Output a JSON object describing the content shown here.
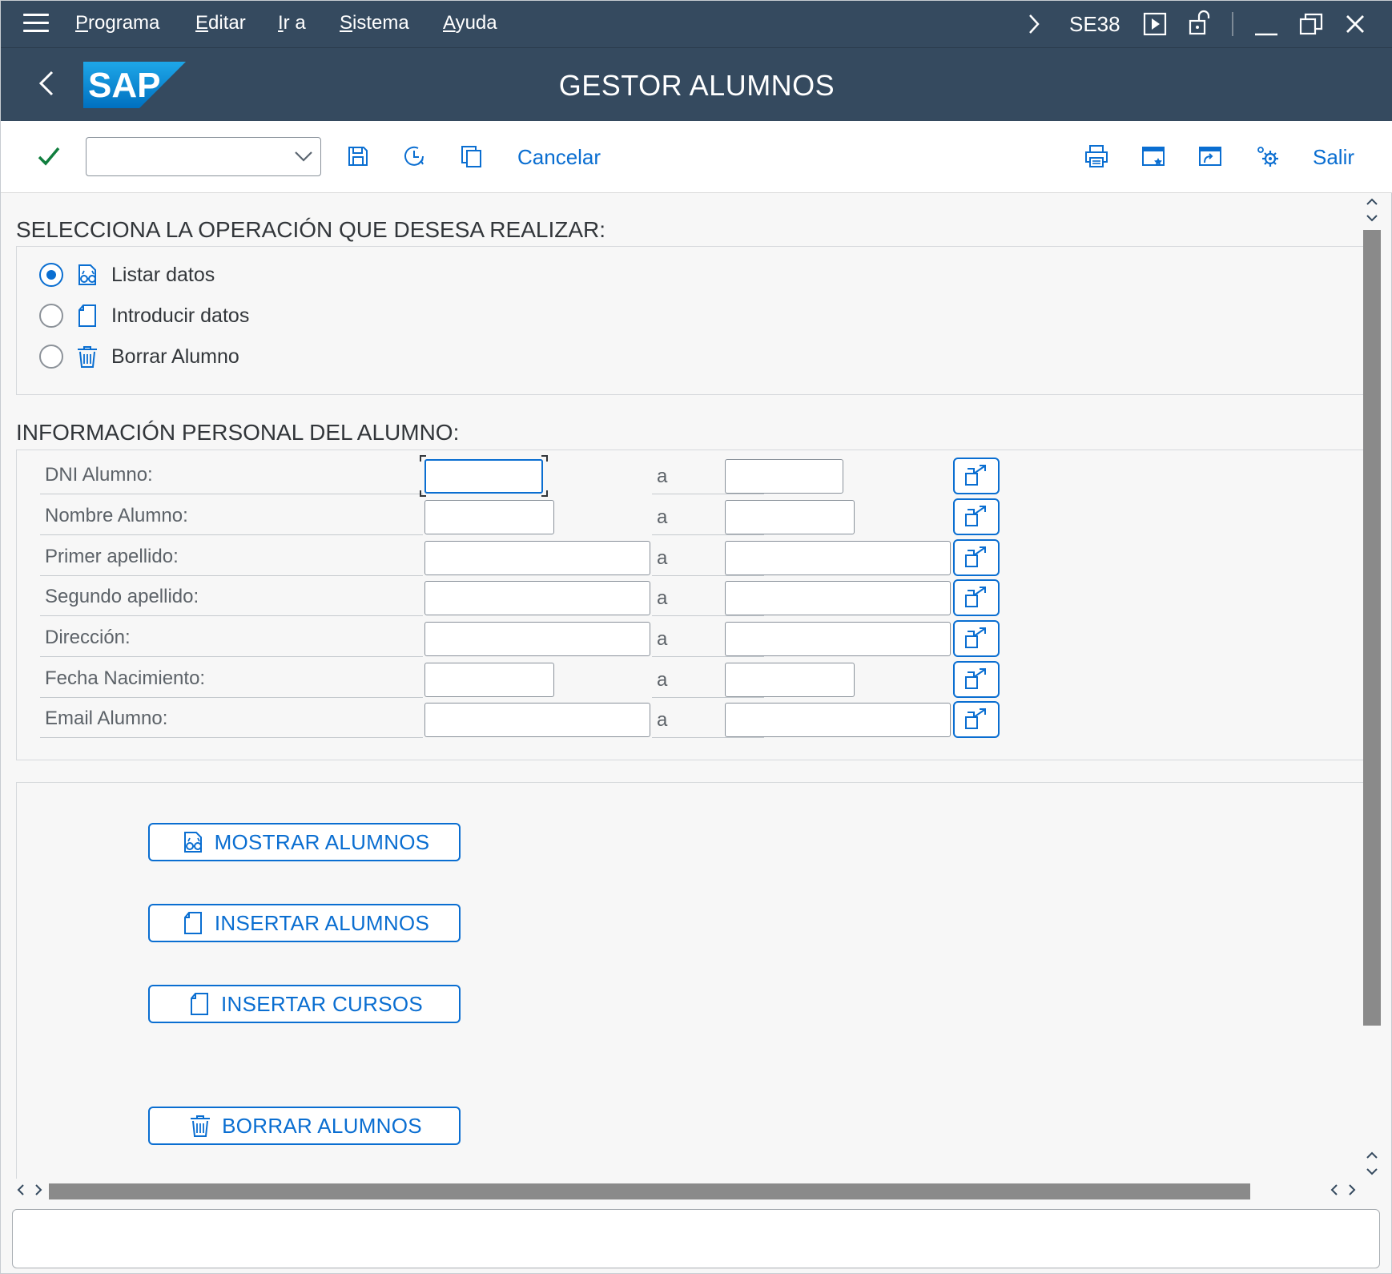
{
  "menubar": {
    "items": [
      "Programa",
      "Editar",
      "Ir a",
      "Sistema",
      "Ayuda"
    ],
    "transaction_code": "SE38"
  },
  "titlebar": {
    "title": "GESTOR ALUMNOS",
    "logo_text": "SAP"
  },
  "toolbar": {
    "command_field_value": "",
    "cancel_label": "Cancelar",
    "exit_label": "Salir"
  },
  "operation": {
    "heading": "SELECCIONA LA OPERACIÓN QUE DESESA REALIZAR:",
    "options": [
      {
        "label": "Listar datos",
        "icon": "display-icon",
        "checked": true
      },
      {
        "label": "Introducir datos",
        "icon": "document-icon",
        "checked": false
      },
      {
        "label": "Borrar Alumno",
        "icon": "trash-icon",
        "checked": false
      }
    ]
  },
  "personal": {
    "heading": "INFORMACIÓN PERSONAL DEL ALUMNO:",
    "range_separator": "a",
    "fields": [
      {
        "label": "DNI Alumno:",
        "from": "",
        "to": ""
      },
      {
        "label": "Nombre Alumno:",
        "from": "",
        "to": ""
      },
      {
        "label": "Primer apellido:",
        "from": "",
        "to": ""
      },
      {
        "label": "Segundo apellido:",
        "from": "",
        "to": ""
      },
      {
        "label": "Dirección:",
        "from": "",
        "to": ""
      },
      {
        "label": "Fecha Nacimiento:",
        "from": "",
        "to": ""
      },
      {
        "label": "Email Alumno:",
        "from": "",
        "to": ""
      }
    ]
  },
  "actions": [
    {
      "label": "MOSTRAR ALUMNOS",
      "icon": "display-icon"
    },
    {
      "label": "INSERTAR ALUMNOS",
      "icon": "document-icon"
    },
    {
      "label": "INSERTAR CURSOS",
      "icon": "document-icon"
    },
    {
      "label": "BORRAR ALUMNOS",
      "icon": "trash-icon"
    }
  ],
  "statusbar": {
    "message": ""
  },
  "colors": {
    "shell": "#354a5f",
    "accent": "#0a6ed1",
    "ok_green": "#107e3e",
    "background": "#f7f7f7"
  }
}
